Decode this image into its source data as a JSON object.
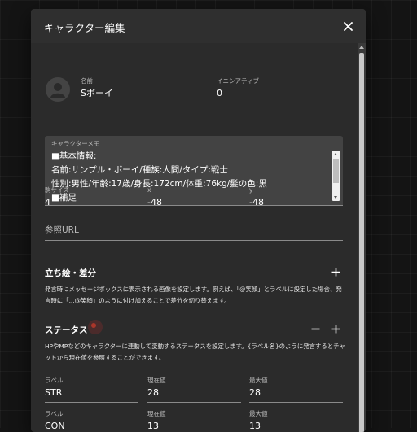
{
  "dialog": {
    "title": "キャラクター編集",
    "close_icon": "close-icon"
  },
  "fields": {
    "name": {
      "label": "名前",
      "value": "Sボーイ"
    },
    "initiative": {
      "label": "イニシアティブ",
      "value": "0"
    }
  },
  "memo": {
    "label": "キャラクターメモ",
    "lines": [
      "■基本情報:",
      "名前:サンプル・ボーイ/種族:人間/タイプ:戦士",
      "性別:男性/年齢:17歳/身長:172cm/体重:76kg/髪の色:黒",
      "■補足"
    ]
  },
  "placement": {
    "size": {
      "label": "駒サイズ",
      "value": "4"
    },
    "x": {
      "label": "x",
      "value": "-48"
    },
    "y": {
      "label": "y",
      "value": "-48"
    }
  },
  "reference_url": {
    "placeholder": "参照URL"
  },
  "portrait": {
    "title": "立ち絵・差分",
    "add_icon": "plus-icon",
    "description": "発言時にメッセージボックスに表示される画像を設定します。例えば、「@笑顔」とラベルに設定した場合、発言時に「...@笑顔」のように付け加えることで差分を切り替えます。"
  },
  "status": {
    "title": "ステータス",
    "remove_icon": "minus-icon",
    "add_icon": "plus-icon",
    "description": "HPやMPなどのキャラクターに連動して変動するステータスを設定します。{ラベル名}のように発言するとチャットから現在値を参照することができます。",
    "columns": {
      "label": "ラベル",
      "current": "現在値",
      "max": "最大値"
    },
    "rows": [
      {
        "label": "STR",
        "current": "28",
        "max": "28"
      },
      {
        "label": "CON",
        "current": "13",
        "max": "13"
      }
    ]
  }
}
